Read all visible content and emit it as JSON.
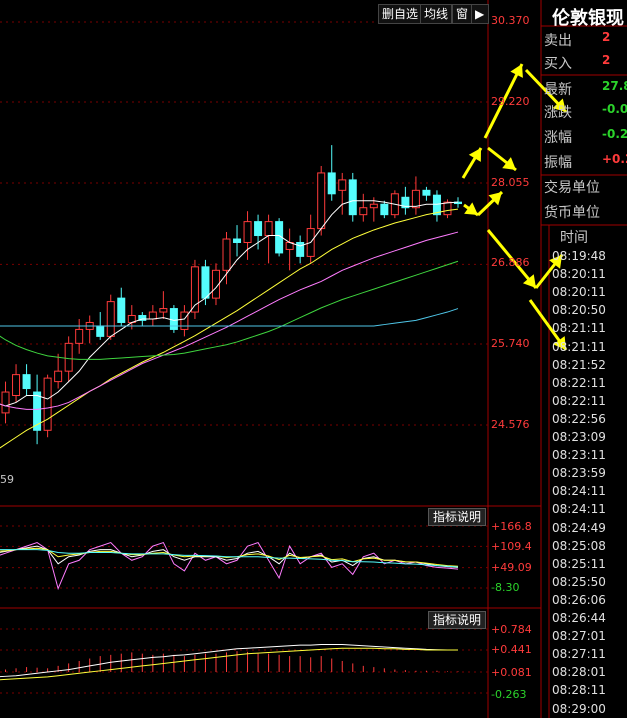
{
  "toolbar": {
    "buttons": [
      "删自选",
      "均线",
      "窗"
    ],
    "arrow_icon": "double-arrow-right-icon"
  },
  "instrument": {
    "name": "伦敦银现"
  },
  "quote": {
    "rows": [
      {
        "label": "卖出",
        "value": "2",
        "color": "#ff3b3b"
      },
      {
        "label": "买入",
        "value": "2",
        "color": "#ff3b3b"
      },
      {
        "label": "最新",
        "value": "27.8",
        "color": "#2bd32b"
      },
      {
        "label": "涨跌",
        "value": "-0.0",
        "color": "#2bd32b"
      },
      {
        "label": "涨幅",
        "value": "-0.2",
        "color": "#2bd32b"
      },
      {
        "label": "振幅",
        "value": "+0.2",
        "color": "#ff3b3b"
      },
      {
        "label": "交易单位",
        "value": "",
        "color": "#c8c8c8"
      },
      {
        "label": "货币单位",
        "value": "",
        "color": "#c8c8c8"
      }
    ]
  },
  "time_list": {
    "header": "时间",
    "times": [
      "08:19:48",
      "08:20:11",
      "08:20:11",
      "08:20:50",
      "08:21:11",
      "08:21:11",
      "08:21:52",
      "08:22:11",
      "08:22:11",
      "08:22:56",
      "08:23:09",
      "08:23:11",
      "08:23:59",
      "08:24:11",
      "08:24:11",
      "08:24:49",
      "08:25:08",
      "08:25:11",
      "08:25:50",
      "08:26:06",
      "08:26:44",
      "08:27:01",
      "08:27:11",
      "08:28:01",
      "08:28:11",
      "08:29:00"
    ]
  },
  "indicator_buttons": [
    "指标说明",
    "指标说明"
  ],
  "corner_label": "59",
  "colors": {
    "up": "#ff3b3b",
    "down": "#54fcfc",
    "ma1": "#ffffff",
    "ma2": "#ffff3b",
    "ma3": "#ff7cff",
    "ma4": "#3fd53f",
    "ma5": "#4fc6e8",
    "arrow": "#ffff00",
    "grid": "#7a0000"
  },
  "chart_data": [
    {
      "type": "candlestick",
      "y_tick_labels": [
        "30.370",
        "29.220",
        "28.055",
        "26.886",
        "25.740",
        "24.576"
      ],
      "y_ticks": [
        30.37,
        29.22,
        28.055,
        26.886,
        25.74,
        24.576
      ],
      "ylim": [
        23.5,
        30.37
      ],
      "candles": [
        {
          "o": 24.5,
          "h": 24.9,
          "l": 24.2,
          "c": 24.75
        },
        {
          "o": 24.75,
          "h": 25.2,
          "l": 24.6,
          "c": 25.05
        },
        {
          "o": 25.0,
          "h": 25.45,
          "l": 24.9,
          "c": 25.3
        },
        {
          "o": 25.3,
          "h": 25.45,
          "l": 25.0,
          "c": 25.1
        },
        {
          "o": 25.05,
          "h": 25.3,
          "l": 24.3,
          "c": 24.5
        },
        {
          "o": 24.5,
          "h": 25.3,
          "l": 24.4,
          "c": 25.25
        },
        {
          "o": 25.2,
          "h": 25.6,
          "l": 25.1,
          "c": 25.35
        },
        {
          "o": 25.35,
          "h": 25.85,
          "l": 25.2,
          "c": 25.75
        },
        {
          "o": 25.75,
          "h": 26.1,
          "l": 25.6,
          "c": 25.95
        },
        {
          "o": 25.95,
          "h": 26.15,
          "l": 25.75,
          "c": 26.05
        },
        {
          "o": 26.0,
          "h": 26.2,
          "l": 25.8,
          "c": 25.85
        },
        {
          "o": 25.85,
          "h": 26.45,
          "l": 25.8,
          "c": 26.35
        },
        {
          "o": 26.4,
          "h": 26.55,
          "l": 26.0,
          "c": 26.05
        },
        {
          "o": 26.05,
          "h": 26.3,
          "l": 25.95,
          "c": 26.15
        },
        {
          "o": 26.15,
          "h": 26.2,
          "l": 26.0,
          "c": 26.08
        },
        {
          "o": 26.1,
          "h": 26.3,
          "l": 26.0,
          "c": 26.2
        },
        {
          "o": 26.2,
          "h": 26.5,
          "l": 26.1,
          "c": 26.25
        },
        {
          "o": 26.25,
          "h": 26.3,
          "l": 25.9,
          "c": 25.95
        },
        {
          "o": 25.95,
          "h": 26.3,
          "l": 25.85,
          "c": 26.2
        },
        {
          "o": 26.2,
          "h": 26.95,
          "l": 26.1,
          "c": 26.85
        },
        {
          "o": 26.85,
          "h": 26.95,
          "l": 26.3,
          "c": 26.4
        },
        {
          "o": 26.4,
          "h": 26.9,
          "l": 26.3,
          "c": 26.8
        },
        {
          "o": 26.8,
          "h": 27.35,
          "l": 26.6,
          "c": 27.25
        },
        {
          "o": 27.25,
          "h": 27.45,
          "l": 27.0,
          "c": 27.2
        },
        {
          "o": 27.2,
          "h": 27.65,
          "l": 26.95,
          "c": 27.5
        },
        {
          "o": 27.5,
          "h": 27.6,
          "l": 27.1,
          "c": 27.3
        },
        {
          "o": 27.3,
          "h": 27.6,
          "l": 26.9,
          "c": 27.5
        },
        {
          "o": 27.5,
          "h": 27.55,
          "l": 27.0,
          "c": 27.05
        },
        {
          "o": 27.1,
          "h": 27.4,
          "l": 26.8,
          "c": 27.2
        },
        {
          "o": 27.2,
          "h": 27.3,
          "l": 26.9,
          "c": 27.0
        },
        {
          "o": 27.0,
          "h": 27.6,
          "l": 26.9,
          "c": 27.4
        },
        {
          "o": 27.4,
          "h": 28.3,
          "l": 27.3,
          "c": 28.2
        },
        {
          "o": 28.2,
          "h": 28.6,
          "l": 27.8,
          "c": 27.9
        },
        {
          "o": 27.95,
          "h": 28.2,
          "l": 27.6,
          "c": 28.1
        },
        {
          "o": 28.1,
          "h": 28.2,
          "l": 27.5,
          "c": 27.6
        },
        {
          "o": 27.6,
          "h": 27.9,
          "l": 27.5,
          "c": 27.7
        },
        {
          "o": 27.7,
          "h": 27.85,
          "l": 27.5,
          "c": 27.75
        },
        {
          "o": 27.75,
          "h": 27.8,
          "l": 27.55,
          "c": 27.6
        },
        {
          "o": 27.6,
          "h": 27.95,
          "l": 27.55,
          "c": 27.9
        },
        {
          "o": 27.85,
          "h": 28.0,
          "l": 27.6,
          "c": 27.7
        },
        {
          "o": 27.7,
          "h": 28.15,
          "l": 27.6,
          "c": 27.95
        },
        {
          "o": 27.95,
          "h": 28.0,
          "l": 27.8,
          "c": 27.88
        },
        {
          "o": 27.88,
          "h": 27.95,
          "l": 27.5,
          "c": 27.6
        },
        {
          "o": 27.6,
          "h": 27.82,
          "l": 27.55,
          "c": 27.78
        },
        {
          "o": 27.78,
          "h": 27.85,
          "l": 27.7,
          "c": 27.76
        }
      ],
      "ma_lines": [
        {
          "color": "#ffffff",
          "values": [
            24.9,
            24.85,
            24.9,
            25.0,
            25.0,
            24.95,
            25.05,
            25.2,
            25.35,
            25.55,
            25.7,
            25.85,
            25.95,
            26.05,
            26.1,
            26.1,
            26.12,
            26.08,
            26.1,
            26.3,
            26.4,
            26.55,
            26.75,
            26.95,
            27.1,
            27.2,
            27.3,
            27.3,
            27.2,
            27.15,
            27.2,
            27.4,
            27.6,
            27.75,
            27.8,
            27.8,
            27.8,
            27.78,
            27.75,
            27.72,
            27.72,
            27.75,
            27.75,
            27.77,
            27.78
          ]
        },
        {
          "color": "#ffff3b",
          "values": [
            24.2,
            24.3,
            24.4,
            24.5,
            24.58,
            24.66,
            24.76,
            24.86,
            24.96,
            25.06,
            25.14,
            25.24,
            25.32,
            25.4,
            25.48,
            25.55,
            25.62,
            25.7,
            25.78,
            25.86,
            25.95,
            26.04,
            26.13,
            26.22,
            26.32,
            26.42,
            26.52,
            26.62,
            26.72,
            26.82,
            26.9,
            27.0,
            27.1,
            27.18,
            27.26,
            27.32,
            27.38,
            27.43,
            27.48,
            27.52,
            27.56,
            27.6,
            27.63,
            27.66,
            27.68
          ]
        },
        {
          "color": "#ff7cff",
          "values": [
            24.9,
            24.85,
            24.82,
            24.8,
            24.8,
            24.82,
            24.85,
            24.9,
            24.98,
            25.06,
            25.14,
            25.22,
            25.3,
            25.38,
            25.46,
            25.52,
            25.58,
            25.64,
            25.7,
            25.77,
            25.84,
            25.91,
            25.98,
            26.06,
            26.14,
            26.22,
            26.3,
            26.38,
            26.45,
            26.52,
            26.58,
            26.64,
            26.72,
            26.8,
            26.86,
            26.92,
            26.98,
            27.03,
            27.08,
            27.13,
            27.18,
            27.23,
            27.27,
            27.31,
            27.35
          ]
        },
        {
          "color": "#3fd53f",
          "values": [
            25.9,
            25.8,
            25.72,
            25.66,
            25.61,
            25.57,
            25.55,
            25.53,
            25.52,
            25.52,
            25.52,
            25.53,
            25.54,
            25.55,
            25.56,
            25.57,
            25.58,
            25.59,
            25.61,
            25.64,
            25.67,
            25.7,
            25.73,
            25.77,
            25.82,
            25.87,
            25.92,
            25.98,
            26.05,
            26.12,
            26.19,
            26.26,
            26.32,
            26.38,
            26.43,
            26.48,
            26.53,
            26.58,
            26.63,
            26.68,
            26.73,
            26.78,
            26.83,
            26.88,
            26.93
          ]
        },
        {
          "color": "#4fc6e8",
          "values": [
            26.0,
            26.0,
            26.0,
            26.0,
            26.0,
            26.0,
            26.0,
            26.0,
            26.0,
            26.0,
            26.0,
            26.0,
            26.0,
            26.0,
            26.0,
            26.0,
            26.0,
            26.0,
            26.0,
            26.0,
            26.0,
            26.0,
            26.0,
            26.0,
            26.0,
            26.0,
            26.0,
            26.0,
            26.0,
            26.0,
            26.0,
            26.0,
            26.0,
            26.0,
            26.0,
            26.0,
            26.0,
            26.02,
            26.04,
            26.06,
            26.08,
            26.12,
            26.16,
            26.2,
            26.25
          ]
        }
      ]
    },
    {
      "type": "line",
      "y_tick_labels": [
        "+166.8",
        "+109.4",
        "+49.09",
        "-8.30"
      ],
      "y_ticks": [
        166.8,
        109.4,
        49.09,
        -8.3
      ],
      "ylim": [
        -30,
        185
      ],
      "series": [
        {
          "color": "#ff7cff",
          "values": [
            80,
            90,
            100,
            110,
            120,
            100,
            -10,
            60,
            70,
            100,
            110,
            120,
            90,
            70,
            80,
            110,
            120,
            60,
            40,
            90,
            70,
            80,
            60,
            70,
            110,
            120,
            70,
            20,
            110,
            60,
            80,
            90,
            50,
            60,
            30,
            80,
            90,
            60,
            70,
            60,
            65,
            55,
            50,
            48,
            45
          ]
        },
        {
          "color": "#ffffff",
          "values": [
            90,
            95,
            100,
            105,
            110,
            100,
            60,
            80,
            85,
            95,
            100,
            100,
            90,
            80,
            85,
            95,
            100,
            80,
            70,
            80,
            80,
            80,
            70,
            75,
            90,
            95,
            80,
            60,
            90,
            75,
            80,
            85,
            65,
            70,
            55,
            75,
            80,
            70,
            70,
            65,
            65,
            60,
            55,
            52,
            50
          ]
        },
        {
          "color": "#ffff3b",
          "values": [
            95,
            97,
            100,
            102,
            104,
            100,
            80,
            85,
            88,
            92,
            95,
            95,
            90,
            86,
            86,
            90,
            92,
            85,
            80,
            82,
            82,
            82,
            78,
            80,
            86,
            88,
            82,
            72,
            84,
            78,
            80,
            82,
            72,
            74,
            66,
            74,
            76,
            70,
            70,
            66,
            65,
            62,
            58,
            55,
            53
          ]
        },
        {
          "color": "#54fcfc",
          "values": [
            100,
            100,
            100,
            100,
            100,
            98,
            92,
            90,
            90,
            92,
            92,
            92,
            90,
            88,
            88,
            88,
            88,
            86,
            84,
            84,
            83,
            82,
            80,
            80,
            80,
            80,
            78,
            76,
            76,
            75,
            74,
            73,
            70,
            69,
            66,
            66,
            65,
            63,
            62,
            60,
            59,
            57,
            55,
            53,
            51
          ]
        }
      ]
    },
    {
      "type": "bar",
      "y_tick_labels": [
        "+0.784",
        "+0.441",
        "+0.081",
        "-0.263"
      ],
      "y_ticks": [
        0.784,
        0.441,
        0.081,
        -0.263
      ],
      "ylim": [
        -0.35,
        0.85
      ],
      "bars": [
        0.03,
        0.04,
        0.06,
        0.08,
        0.07,
        0.06,
        0.1,
        0.14,
        0.18,
        0.22,
        0.26,
        0.28,
        0.3,
        0.32,
        0.3,
        0.28,
        0.3,
        0.28,
        0.26,
        0.28,
        0.3,
        0.3,
        0.32,
        0.34,
        0.33,
        0.3,
        0.3,
        0.28,
        0.26,
        0.26,
        0.24,
        0.26,
        0.22,
        0.18,
        0.14,
        0.1,
        0.08,
        0.06,
        0.04,
        0.03,
        0.02,
        0.02,
        0.02,
        0.01,
        0.01
      ],
      "series": [
        {
          "color": "#ffffff",
          "values": [
            0.0,
            0.01,
            0.02,
            0.04,
            0.06,
            0.08,
            0.1,
            0.12,
            0.15,
            0.18,
            0.21,
            0.24,
            0.26,
            0.28,
            0.3,
            0.32,
            0.33,
            0.35,
            0.36,
            0.38,
            0.4,
            0.42,
            0.44,
            0.46,
            0.47,
            0.48,
            0.49,
            0.5,
            0.51,
            0.52,
            0.52,
            0.53,
            0.53,
            0.53,
            0.52,
            0.51,
            0.5,
            0.49,
            0.48,
            0.47,
            0.46,
            0.45,
            0.445,
            0.44,
            0.44
          ]
        },
        {
          "color": "#ffff3b",
          "values": [
            -0.05,
            -0.04,
            -0.03,
            -0.02,
            -0.01,
            0.0,
            0.02,
            0.04,
            0.06,
            0.08,
            0.1,
            0.12,
            0.14,
            0.16,
            0.18,
            0.2,
            0.22,
            0.24,
            0.26,
            0.28,
            0.3,
            0.32,
            0.34,
            0.36,
            0.38,
            0.39,
            0.4,
            0.41,
            0.42,
            0.43,
            0.44,
            0.45,
            0.46,
            0.47,
            0.47,
            0.47,
            0.47,
            0.46,
            0.46,
            0.45,
            0.45,
            0.44,
            0.44,
            0.44,
            0.44
          ]
        }
      ]
    }
  ]
}
